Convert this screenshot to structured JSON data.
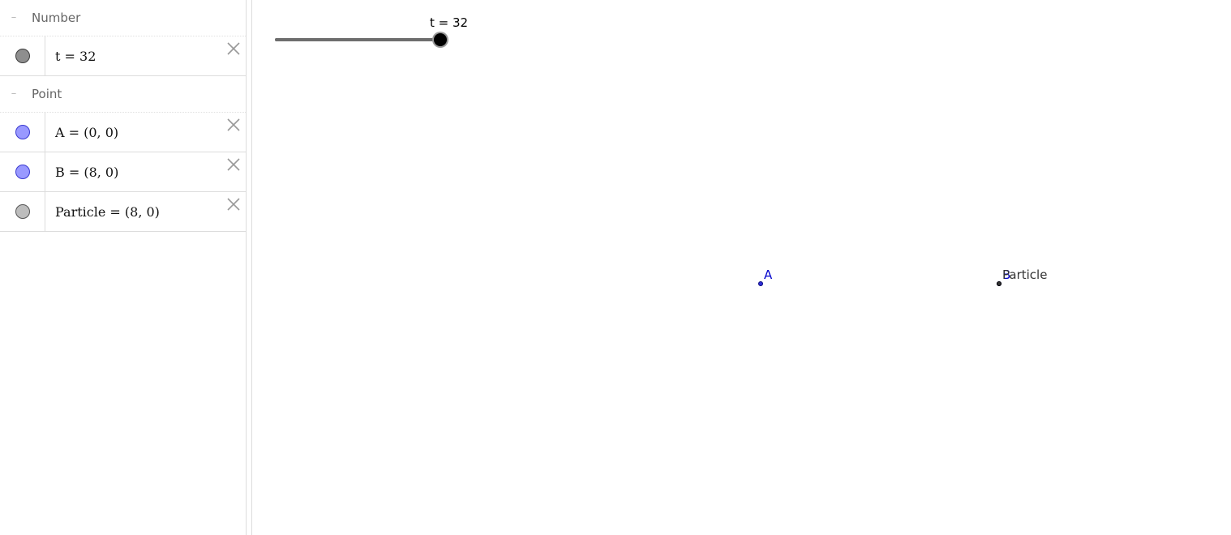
{
  "algebra": {
    "groups": [
      {
        "label": "Number",
        "toggle": "–",
        "items": [
          {
            "expr": "t = 32",
            "marble_color": "#8e8e8e"
          }
        ]
      },
      {
        "label": "Point",
        "toggle": "–",
        "items": [
          {
            "expr": "A = (0, 0)",
            "marble_color": "#9999ff"
          },
          {
            "expr": "B = (8, 0)",
            "marble_color": "#9999ff"
          },
          {
            "expr": "Particle = (8, 0)",
            "marble_color": "#bdbdbd"
          }
        ]
      }
    ]
  },
  "graphics": {
    "slider": {
      "caption": "t = 32",
      "value": 32,
      "min": 0,
      "max": 32
    },
    "points": [
      {
        "name": "A",
        "x": 0,
        "y": 0,
        "color": "#0000cc"
      },
      {
        "name": "B",
        "x": 8,
        "y": 0,
        "color": "#0000cc"
      },
      {
        "name": "Particle",
        "x": 8,
        "y": 0,
        "color": "#333333"
      }
    ]
  }
}
